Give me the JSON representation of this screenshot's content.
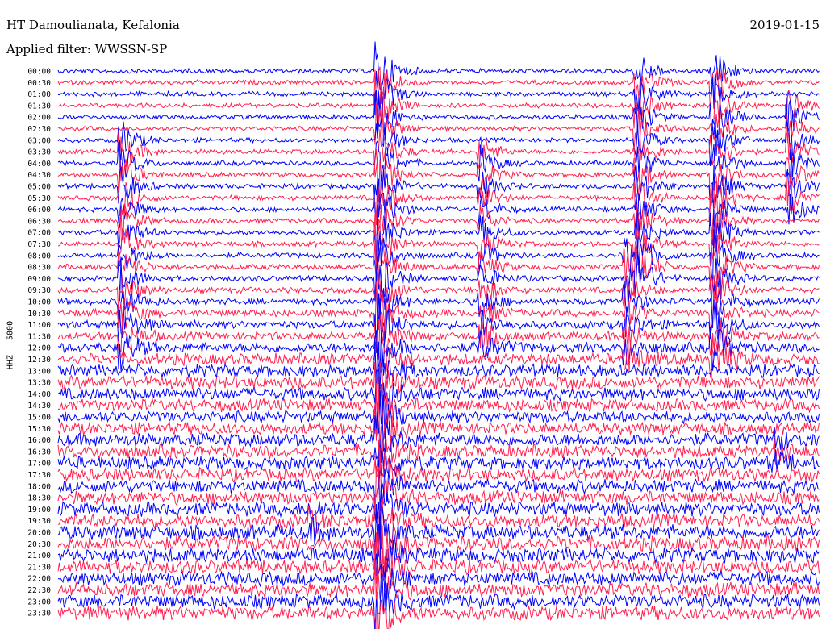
{
  "header": {
    "station": "HT Damoulianata, Kefalonia",
    "filter": "Applied filter: WWSSN-SP",
    "date": "2019-01-15",
    "channel": "HHZ - 5000"
  },
  "colors": {
    "trace_a": "#0000ff",
    "trace_b": "#ff1f4f"
  },
  "chart_data": {
    "type": "helicorder",
    "title": "HT Damoulianata, Kefalonia",
    "subtitle": "Applied filter: WWSSN-SP",
    "date": "2019-01-15",
    "ylabel": "HHZ - 5000",
    "row_labels": [
      "00:00",
      "00:30",
      "01:00",
      "01:30",
      "02:00",
      "02:30",
      "03:00",
      "03:30",
      "04:00",
      "04:30",
      "05:00",
      "05:30",
      "06:00",
      "06:30",
      "07:00",
      "07:30",
      "08:00",
      "08:30",
      "09:00",
      "09:30",
      "10:00",
      "10:30",
      "11:00",
      "11:30",
      "12:00",
      "12:30",
      "13:00",
      "13:30",
      "14:00",
      "14:30",
      "15:00",
      "15:30",
      "16:00",
      "16:30",
      "17:00",
      "17:30",
      "18:00",
      "18:30",
      "19:00",
      "19:30",
      "20:00",
      "20:30",
      "21:00",
      "21:30",
      "22:00",
      "22:30",
      "23:00",
      "23:30"
    ],
    "row_colors": [
      "blue",
      "red"
    ],
    "row_noise": [
      0.08,
      0.08,
      0.08,
      0.08,
      0.08,
      0.08,
      0.08,
      0.09,
      0.09,
      0.09,
      0.1,
      0.1,
      0.1,
      0.1,
      0.12,
      0.12,
      0.12,
      0.14,
      0.14,
      0.16,
      0.2,
      0.25,
      0.3,
      0.35,
      0.45,
      0.55,
      0.6,
      0.65,
      0.6,
      0.6,
      0.55,
      0.6,
      0.65,
      0.65,
      0.65,
      0.65,
      0.65,
      0.65,
      0.7,
      0.7,
      0.75,
      0.75,
      0.75,
      0.7,
      0.7,
      0.7,
      0.7,
      0.7
    ],
    "events": [
      {
        "t": 0.082,
        "rows": [
          6,
          7,
          8,
          9,
          10,
          11,
          12,
          13,
          14,
          15,
          16,
          17,
          18,
          19,
          20,
          21,
          22,
          23,
          24
        ],
        "amp": 3.0
      },
      {
        "t": 0.42,
        "rows": [
          0,
          1,
          2,
          3,
          4,
          5,
          6,
          7,
          8,
          9,
          10,
          11,
          12,
          13,
          14,
          15,
          16,
          17,
          18,
          19,
          20,
          21,
          22,
          23,
          24,
          25,
          26,
          27,
          28,
          29,
          30,
          31,
          32,
          33,
          34,
          35,
          36,
          37,
          38,
          39,
          40,
          41,
          42,
          43,
          44,
          45,
          46,
          47
        ],
        "amp": 4.0
      },
      {
        "t": 0.555,
        "rows": [
          7,
          8,
          9,
          10,
          11,
          12,
          13,
          14,
          15,
          16,
          17,
          18,
          19,
          20,
          21,
          22,
          23,
          24
        ],
        "amp": 2.2
      },
      {
        "t": 0.745,
        "rows": [
          16,
          17,
          18,
          19,
          20,
          21,
          22,
          23,
          24,
          25
        ],
        "amp": 2.5
      },
      {
        "t": 0.76,
        "rows": [
          0,
          1,
          2,
          3,
          4,
          5,
          6,
          7,
          8,
          9,
          10,
          11,
          12,
          13,
          14,
          15,
          16,
          17,
          18
        ],
        "amp": 3.0
      },
      {
        "t": 0.86,
        "rows": [
          0,
          1,
          2,
          3,
          4,
          5,
          6,
          7,
          8,
          9,
          10,
          11,
          12,
          13,
          14,
          15,
          16,
          17,
          18,
          19,
          20,
          21,
          22,
          23,
          24,
          25
        ],
        "amp": 3.5
      },
      {
        "t": 0.96,
        "rows": [
          3,
          4,
          5,
          6,
          7,
          8,
          9,
          10,
          11,
          12
        ],
        "amp": 2.6
      },
      {
        "t": 0.33,
        "rows": [
          38,
          39,
          40
        ],
        "amp": 1.4
      },
      {
        "t": 0.94,
        "rows": [
          32,
          33,
          34
        ],
        "amp": 1.3
      }
    ]
  }
}
